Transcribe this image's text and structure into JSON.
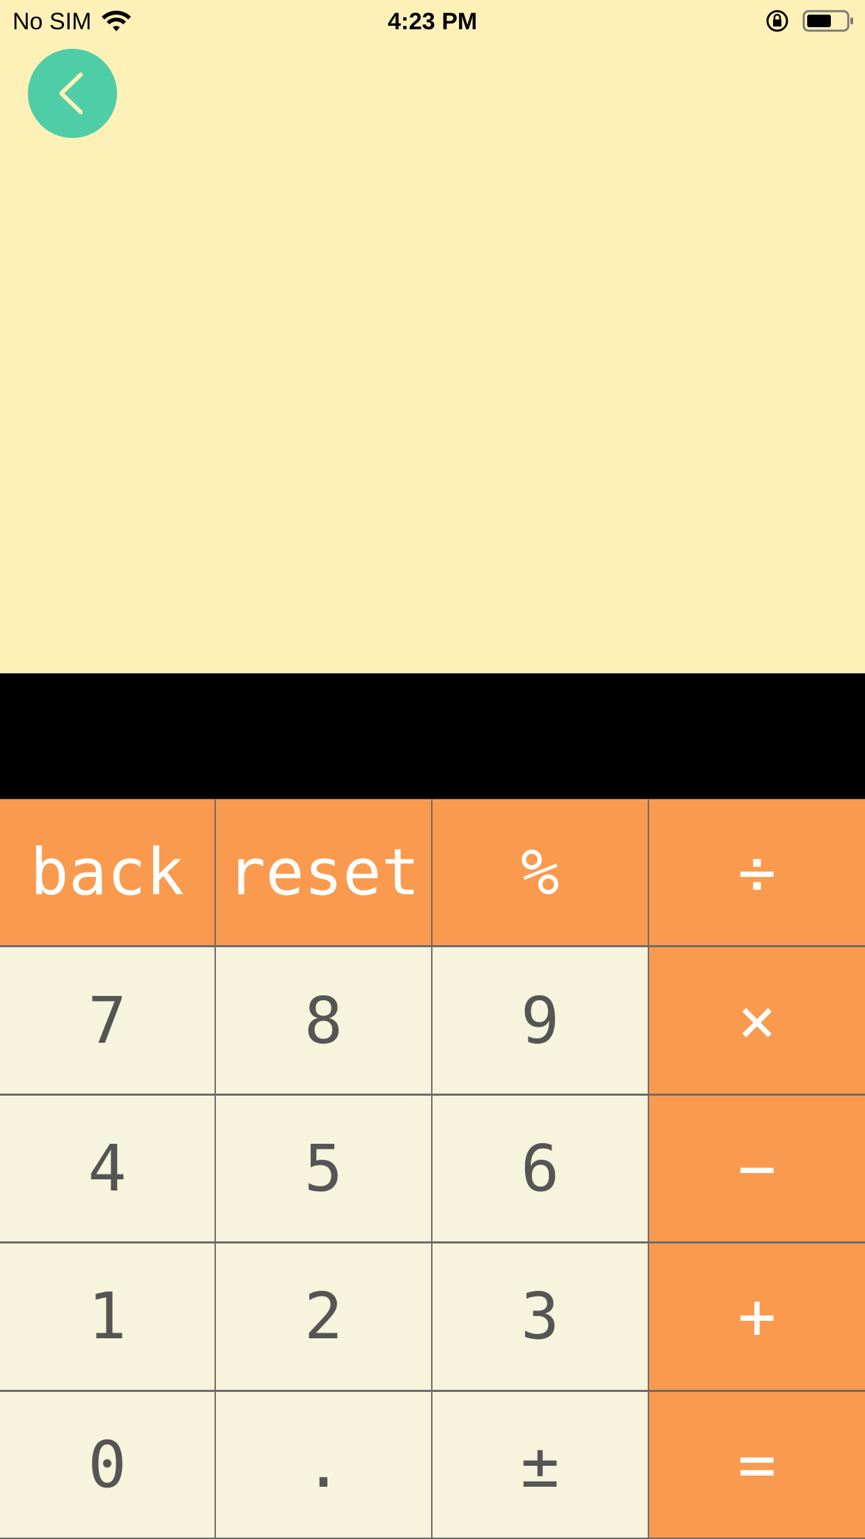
{
  "status_bar": {
    "carrier": "No SIM",
    "time": "4:23 PM"
  },
  "display": {
    "value": ""
  },
  "keypad": {
    "rows": [
      [
        {
          "label": "back",
          "kind": "op",
          "name": "back-key"
        },
        {
          "label": "reset",
          "kind": "op",
          "name": "reset-key"
        },
        {
          "label": "%",
          "kind": "op",
          "name": "percent-key"
        },
        {
          "label": "÷",
          "kind": "op",
          "name": "divide-key"
        }
      ],
      [
        {
          "label": "7",
          "kind": "num",
          "name": "digit-7-key"
        },
        {
          "label": "8",
          "kind": "num",
          "name": "digit-8-key"
        },
        {
          "label": "9",
          "kind": "num",
          "name": "digit-9-key"
        },
        {
          "label": "×",
          "kind": "op",
          "name": "multiply-key"
        }
      ],
      [
        {
          "label": "4",
          "kind": "num",
          "name": "digit-4-key"
        },
        {
          "label": "5",
          "kind": "num",
          "name": "digit-5-key"
        },
        {
          "label": "6",
          "kind": "num",
          "name": "digit-6-key"
        },
        {
          "label": "−",
          "kind": "op",
          "name": "subtract-key"
        }
      ],
      [
        {
          "label": "1",
          "kind": "num",
          "name": "digit-1-key"
        },
        {
          "label": "2",
          "kind": "num",
          "name": "digit-2-key"
        },
        {
          "label": "3",
          "kind": "num",
          "name": "digit-3-key"
        },
        {
          "label": "+",
          "kind": "op",
          "name": "add-key"
        }
      ],
      [
        {
          "label": "0",
          "kind": "num",
          "name": "digit-0-key"
        },
        {
          "label": ".",
          "kind": "num",
          "name": "decimal-key"
        },
        {
          "label": "±",
          "kind": "num",
          "name": "sign-toggle-key"
        },
        {
          "label": "=",
          "kind": "op",
          "name": "equals-key"
        }
      ]
    ]
  },
  "icons": {
    "nav_back": "chevron-left-icon",
    "wifi": "wifi-icon",
    "orientation_lock": "orientation-lock-icon",
    "battery": "battery-icon"
  },
  "colors": {
    "background": "#FEF1B8",
    "accent_green": "#4FCDA6",
    "operator_orange": "#FA9A4E",
    "number_key": "#F6F4DC",
    "display": "#000000"
  }
}
